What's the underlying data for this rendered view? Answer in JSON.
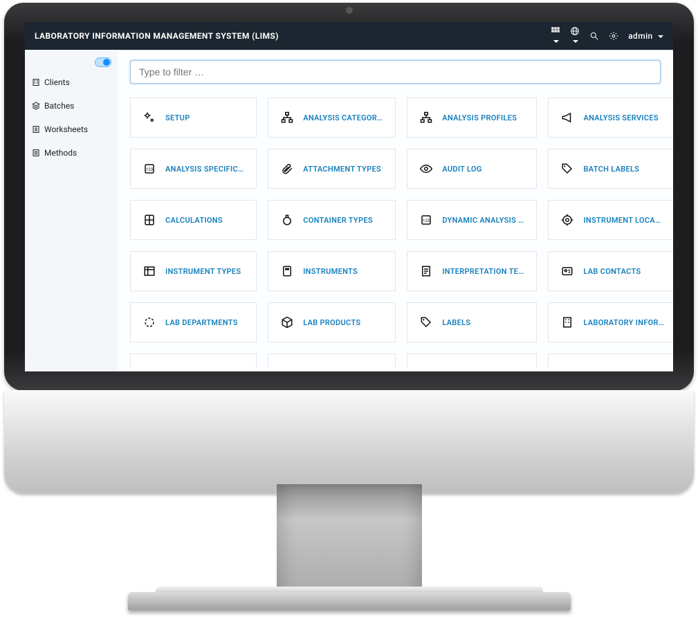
{
  "topbar": {
    "title": "LABORATORY INFORMATION MANAGEMENT SYSTEM (LIMS)",
    "user_label": "admin"
  },
  "sidebar": {
    "items": [
      {
        "label": "Clients"
      },
      {
        "label": "Batches"
      },
      {
        "label": "Worksheets"
      },
      {
        "label": "Methods"
      }
    ]
  },
  "filter": {
    "placeholder": "Type to filter …",
    "value": ""
  },
  "cards": [
    {
      "label": "SETUP"
    },
    {
      "label": "ANALYSIS CATEGOR…"
    },
    {
      "label": "ANALYSIS PROFILES"
    },
    {
      "label": "ANALYSIS SERVICES"
    },
    {
      "label": "ANALYSIS SPECIFIC…"
    },
    {
      "label": "ATTACHMENT TYPES"
    },
    {
      "label": "AUDIT LOG"
    },
    {
      "label": "BATCH LABELS"
    },
    {
      "label": "CALCULATIONS"
    },
    {
      "label": "CONTAINER TYPES"
    },
    {
      "label": "DYNAMIC ANALYSIS …"
    },
    {
      "label": "INSTRUMENT LOCA…"
    },
    {
      "label": "INSTRUMENT TYPES"
    },
    {
      "label": "INSTRUMENTS"
    },
    {
      "label": "INTERPRETATION TE…"
    },
    {
      "label": "LAB CONTACTS"
    },
    {
      "label": "LAB DEPARTMENTS"
    },
    {
      "label": "LAB PRODUCTS"
    },
    {
      "label": "LABELS"
    },
    {
      "label": "LABORATORY INFOR…"
    }
  ]
}
